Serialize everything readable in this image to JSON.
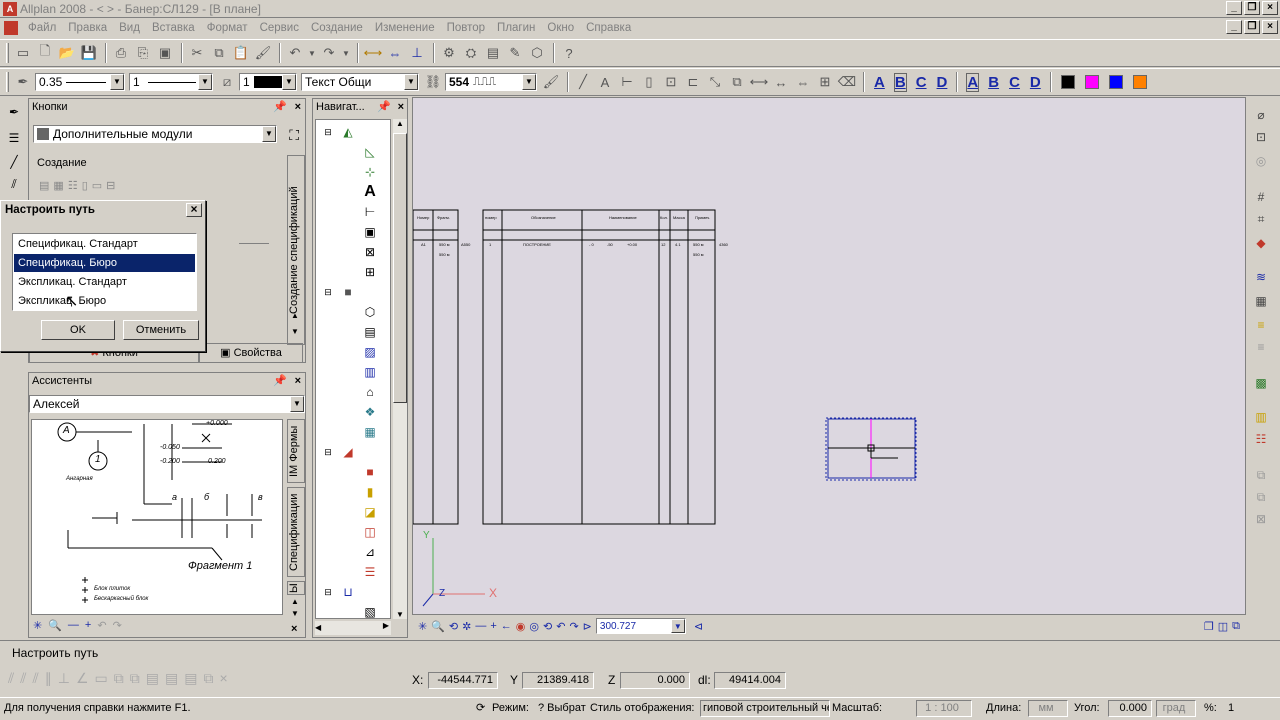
{
  "window": {
    "title": "Allplan 2008 - <    > - Банер:СЛ129 - [В плане]",
    "logo": "A"
  },
  "menu": [
    "Файл",
    "Правка",
    "Вид",
    "Вставка",
    "Формат",
    "Сервис",
    "Создание",
    "Изменение",
    "Повтор",
    "Плагин",
    "Окно",
    "Справка"
  ],
  "format_bar": {
    "pen_thickness": "0.35",
    "line_type": "1",
    "color_index": "1",
    "text_style": "Текст Общи",
    "hatch_num": "554",
    "text_letters": [
      "A",
      "B",
      "C",
      "D"
    ],
    "dim_letters": [
      "A",
      "B",
      "C",
      "D"
    ],
    "colors": [
      "#000000",
      "#ff00ff",
      "#0000ff",
      "#ff8000"
    ]
  },
  "buttons_panel": {
    "title": "Кнопки",
    "module": "Дополнительные модули",
    "section": "Создание",
    "vertical_tab": "Создание спецификаций",
    "bottom_tabs": [
      "Кнопки",
      "Свойства"
    ]
  },
  "navigator": {
    "title": "Навигат..."
  },
  "assistants": {
    "title": "Ассистенты",
    "user": "Алексей",
    "tabs": [
      "IM Фермы",
      "Спецификации",
      "Ы"
    ],
    "sketch_texts": [
      "A",
      "1",
      "Фрагмент 1",
      "+0.000",
      "-0.050",
      "-0.200",
      "0.200",
      "Ангарная",
      "Блок плиток",
      "Бескаркасный блок",
      "а",
      "б",
      "в"
    ]
  },
  "dialog": {
    "title": "Настроить путь",
    "items": [
      "Спецификац. Стандарт",
      "Спецификац. Бюро",
      "Экспликац. Стандарт",
      "Экспликац. Бюро"
    ],
    "selected_index": 1,
    "ok": "OK",
    "cancel": "Отменить"
  },
  "canvas": {
    "zoom": "300.727",
    "axis_x": "X",
    "axis_y": "Y",
    "axis_z": "Z"
  },
  "command_line": "Настроить путь",
  "coords": {
    "x_label": "X:",
    "x": "-44544.771",
    "y_label": "Y",
    "y": "21389.418",
    "z_label": "Z",
    "z": "0.000",
    "dl_label": "dl:",
    "dl": "49414.004"
  },
  "status": {
    "help": "Для получения справки нажмите F1.",
    "mode_label": "Режим:",
    "mode": "? Выбрат",
    "style_label": "Стиль отображения:",
    "style": "гиповой строительный чертеж",
    "scale_label": "Масштаб:",
    "scale": "1 : 100",
    "length_label": "Длина:",
    "length_unit": "мм",
    "angle_label": "Угол:",
    "angle": "0.000",
    "angle_unit": "град",
    "percent_label": "%:",
    "percent": "1"
  }
}
